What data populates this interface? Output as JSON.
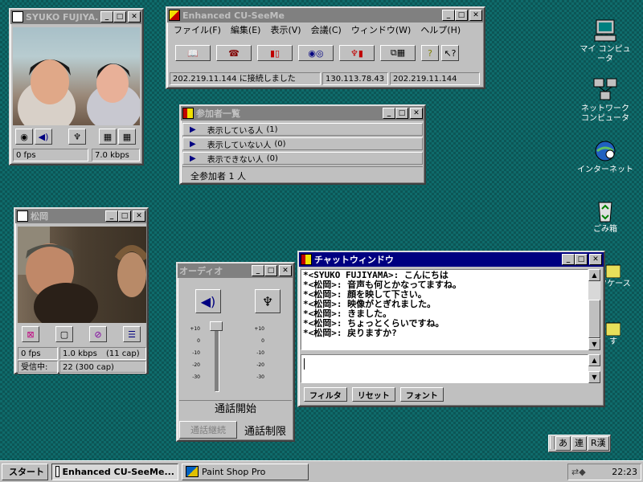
{
  "desktop": {
    "icons": [
      {
        "label": "マイ コンピュータ",
        "icon": "computer-icon"
      },
      {
        "label": "ネットワーク\nコンピュータ",
        "icon": "network-icon"
      },
      {
        "label": "インターネット",
        "icon": "internet-icon"
      },
      {
        "label": "ごみ箱",
        "icon": "recycle-bin-icon"
      },
      {
        "label": "クケース",
        "icon": "briefcase-icon"
      },
      {
        "label": "す",
        "icon": "folder-icon"
      }
    ]
  },
  "video1": {
    "title": "SYUKO FUJIYA...",
    "fps": "0 fps",
    "kbps": "7.0 kbps"
  },
  "main": {
    "title": "Enhanced CU-SeeMe",
    "menu": [
      "ファイル(F)",
      "編集(E)",
      "表示(V)",
      "会議(C)",
      "ウィンドウ(W)",
      "ヘルプ(H)"
    ],
    "status": [
      "202.219.11.144 に接続しました",
      "130.113.78.43",
      "202.219.11.144"
    ]
  },
  "participants": {
    "title": "参加者一覧",
    "rows": [
      {
        "label": "表示している人",
        "count": "(1)"
      },
      {
        "label": "表示していない人",
        "count": "(0)"
      },
      {
        "label": "表示できない人",
        "count": "(0)"
      }
    ],
    "total": "全参加者 1 人"
  },
  "video2": {
    "title": "松岡",
    "fps": "0 fps",
    "kbps": "1.0 kbps",
    "cap": "(11 cap)",
    "recv_label": "受信中:",
    "recv_value": "22 (300 cap)"
  },
  "audio": {
    "title": "オーディオ",
    "scale_left": [
      "+10",
      "0",
      "-10",
      "-20",
      "-30"
    ],
    "scale_right": [
      "+10",
      "0",
      "-10",
      "-20",
      "-30"
    ],
    "talk_start": "通話開始",
    "talk_continue": "通話継続",
    "talk_limit": "通話制限"
  },
  "chat": {
    "title": "チャットウィンドウ",
    "lines": [
      "*<SYUKO FUJIYAMA>: こんにちは",
      "*<松岡>: 音声も何とかなってますね。",
      "*<松岡>: 顔を映して下さい。",
      "*<松岡>: 映像がとぎれました。",
      "*<松岡>: きました。",
      "*<松岡>: ちょっとくらいですね。",
      "*<松岡>: 戻りますか?"
    ],
    "input_value": "",
    "buttons": {
      "filter": "フィルタ",
      "reset": "リセット",
      "font": "フォント"
    }
  },
  "ime": {
    "items": [
      "あ",
      "連",
      "R漢"
    ]
  },
  "taskbar": {
    "start": "スタート",
    "tasks": [
      "Enhanced CU-SeeMe...",
      "Paint Shop Pro"
    ],
    "clock": "22:23"
  },
  "colors": {
    "desktop": "#0f6b6b",
    "active_title": "#000080",
    "inactive_title": "#808080"
  }
}
